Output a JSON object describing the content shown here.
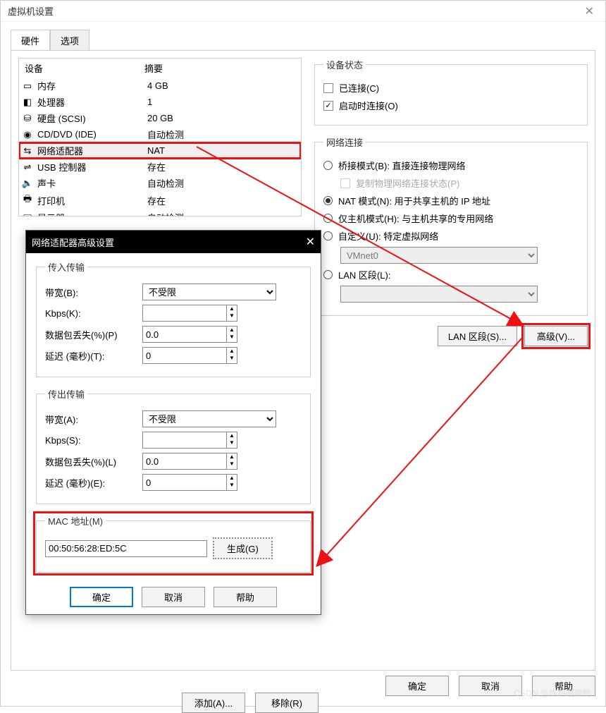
{
  "window": {
    "title": "虚拟机设置"
  },
  "tabs": {
    "hardware": "硬件",
    "options": "选项"
  },
  "devtable": {
    "head_device": "设备",
    "head_summary": "摘要",
    "rows": [
      {
        "name": "内存",
        "summary": "4 GB"
      },
      {
        "name": "处理器",
        "summary": "1"
      },
      {
        "name": "硬盘 (SCSI)",
        "summary": "20 GB"
      },
      {
        "name": "CD/DVD (IDE)",
        "summary": "自动检测"
      },
      {
        "name": "网络适配器",
        "summary": "NAT"
      },
      {
        "name": "USB 控制器",
        "summary": "存在"
      },
      {
        "name": "声卡",
        "summary": "自动检测"
      },
      {
        "name": "打印机",
        "summary": "存在"
      },
      {
        "name": "显示器",
        "summary": "自动检测"
      }
    ]
  },
  "status": {
    "legend": "设备状态",
    "connected": "已连接(C)",
    "connect_on": "启动时连接(O)"
  },
  "netconn": {
    "legend": "网络连接",
    "bridge": "桥接模式(B): 直接连接物理网络",
    "replicate": "复制物理网络连接状态(P)",
    "nat": "NAT 模式(N): 用于共享主机的 IP 地址",
    "host": "仅主机模式(H): 与主机共享的专用网络",
    "custom": "自定义(U): 特定虚拟网络",
    "vmnet": "VMnet0",
    "lan": "LAN 区段(L):"
  },
  "netbuttons": {
    "lanseg": "LAN 区段(S)...",
    "advanced": "高级(V)..."
  },
  "bottom": {
    "add": "添加(A)...",
    "remove": "移除(R)",
    "ok": "确定",
    "cancel": "取消",
    "help": "帮助"
  },
  "modal": {
    "title": "网络适配器高级设置",
    "in_legend": "传入传输",
    "out_legend": "传出传输",
    "bandwidth_b": "带宽(B):",
    "bandwidth_a": "带宽(A):",
    "unlimited": "不受限",
    "kbps_k": "Kbps(K):",
    "kbps_s": "Kbps(S):",
    "loss_p": "数据包丢失(%)(P)",
    "loss_l": "数据包丢失(%)(L)",
    "delay_t": "延迟 (毫秒)(T):",
    "delay_e": "延迟 (毫秒)(E):",
    "loss_val": "0.0",
    "delay_val": "0",
    "mac_legend": "MAC 地址(M)",
    "mac": "00:50:56:28:ED:5C",
    "generate": "生成(G)",
    "ok": "确定",
    "cancel": "取消",
    "help": "帮助"
  },
  "watermark": "CSDN @炸鸡嘎嘣脆"
}
